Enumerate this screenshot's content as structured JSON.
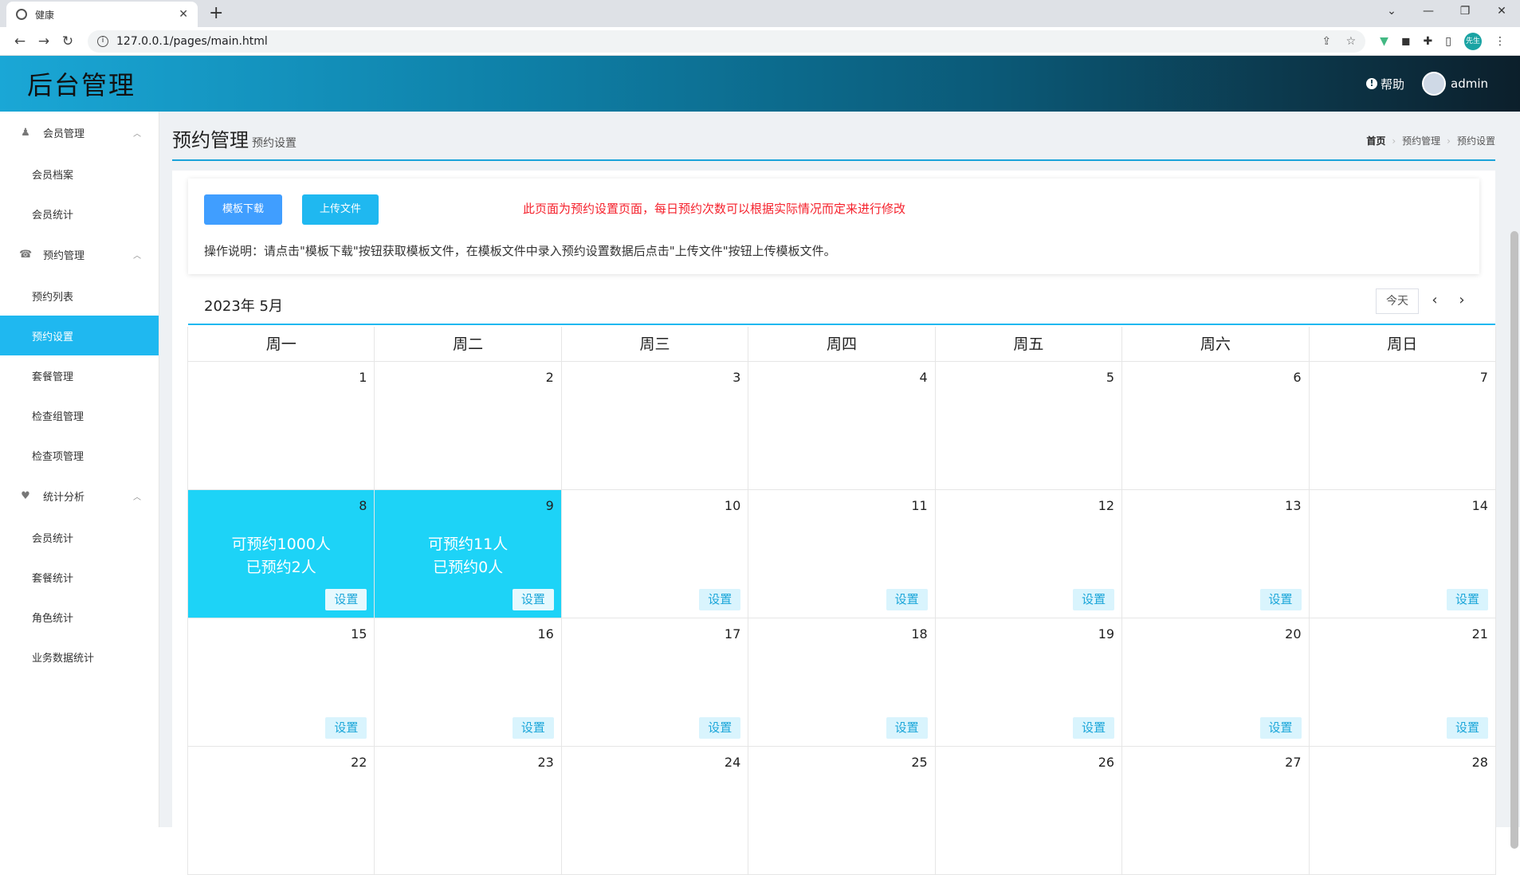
{
  "browser": {
    "tab_title": "健康",
    "url": "127.0.0.1/pages/main.html",
    "ext_avatar": "先生"
  },
  "header": {
    "logo": "后台管理",
    "help": "帮助",
    "user": "admin"
  },
  "sidebar": {
    "groups": [
      {
        "label": "会员管理",
        "items": [
          "会员档案",
          "会员统计"
        ]
      },
      {
        "label": "预约管理",
        "items": [
          "预约列表",
          "预约设置",
          "套餐管理",
          "检查组管理",
          "检查项管理"
        ]
      },
      {
        "label": "统计分析",
        "items": [
          "会员统计",
          "套餐统计",
          "角色统计",
          "业务数据统计"
        ]
      }
    ],
    "active": "预约设置"
  },
  "page": {
    "title": "预约管理",
    "subtitle": "预约设置",
    "breadcrumb": [
      "首页",
      "预约管理",
      "预约设置"
    ]
  },
  "panel": {
    "download_label": "模板下载",
    "upload_label": "上传文件",
    "notice": "此页面为预约设置页面，每日预约次数可以根据实际情况而定来进行修改",
    "instructions": "操作说明：请点击\"模板下载\"按钮获取模板文件，在模板文件中录入预约设置数据后点击\"上传文件\"按钮上传模板文件。"
  },
  "calendar": {
    "title": "2023年 5月",
    "today_label": "今天",
    "prev": "‹",
    "next": "›",
    "weekdays": [
      "周一",
      "周二",
      "周三",
      "周四",
      "周五",
      "周六",
      "周日"
    ],
    "set_label": "设置",
    "weeks": [
      [
        {
          "d": "1"
        },
        {
          "d": "2"
        },
        {
          "d": "3"
        },
        {
          "d": "4"
        },
        {
          "d": "5"
        },
        {
          "d": "6"
        },
        {
          "d": "7"
        }
      ],
      [
        {
          "d": "8",
          "line1": "可预约1000人",
          "line2": "已预约2人",
          "set": true
        },
        {
          "d": "9",
          "line1": "可预约11人",
          "line2": "已预约0人",
          "set": true
        },
        {
          "d": "10",
          "set": true
        },
        {
          "d": "11",
          "set": true
        },
        {
          "d": "12",
          "set": true
        },
        {
          "d": "13",
          "set": true
        },
        {
          "d": "14",
          "set": true
        }
      ],
      [
        {
          "d": "15",
          "set": true
        },
        {
          "d": "16",
          "set": true
        },
        {
          "d": "17",
          "set": true
        },
        {
          "d": "18",
          "set": true
        },
        {
          "d": "19",
          "set": true
        },
        {
          "d": "20",
          "set": true
        },
        {
          "d": "21",
          "set": true
        }
      ],
      [
        {
          "d": "22"
        },
        {
          "d": "23"
        },
        {
          "d": "24"
        },
        {
          "d": "25"
        },
        {
          "d": "26"
        },
        {
          "d": "27"
        },
        {
          "d": "28"
        }
      ]
    ]
  },
  "colors": {
    "accent": "#1fb8f0",
    "booked_cell": "#1dd3f7",
    "notice": "#f5222d"
  }
}
